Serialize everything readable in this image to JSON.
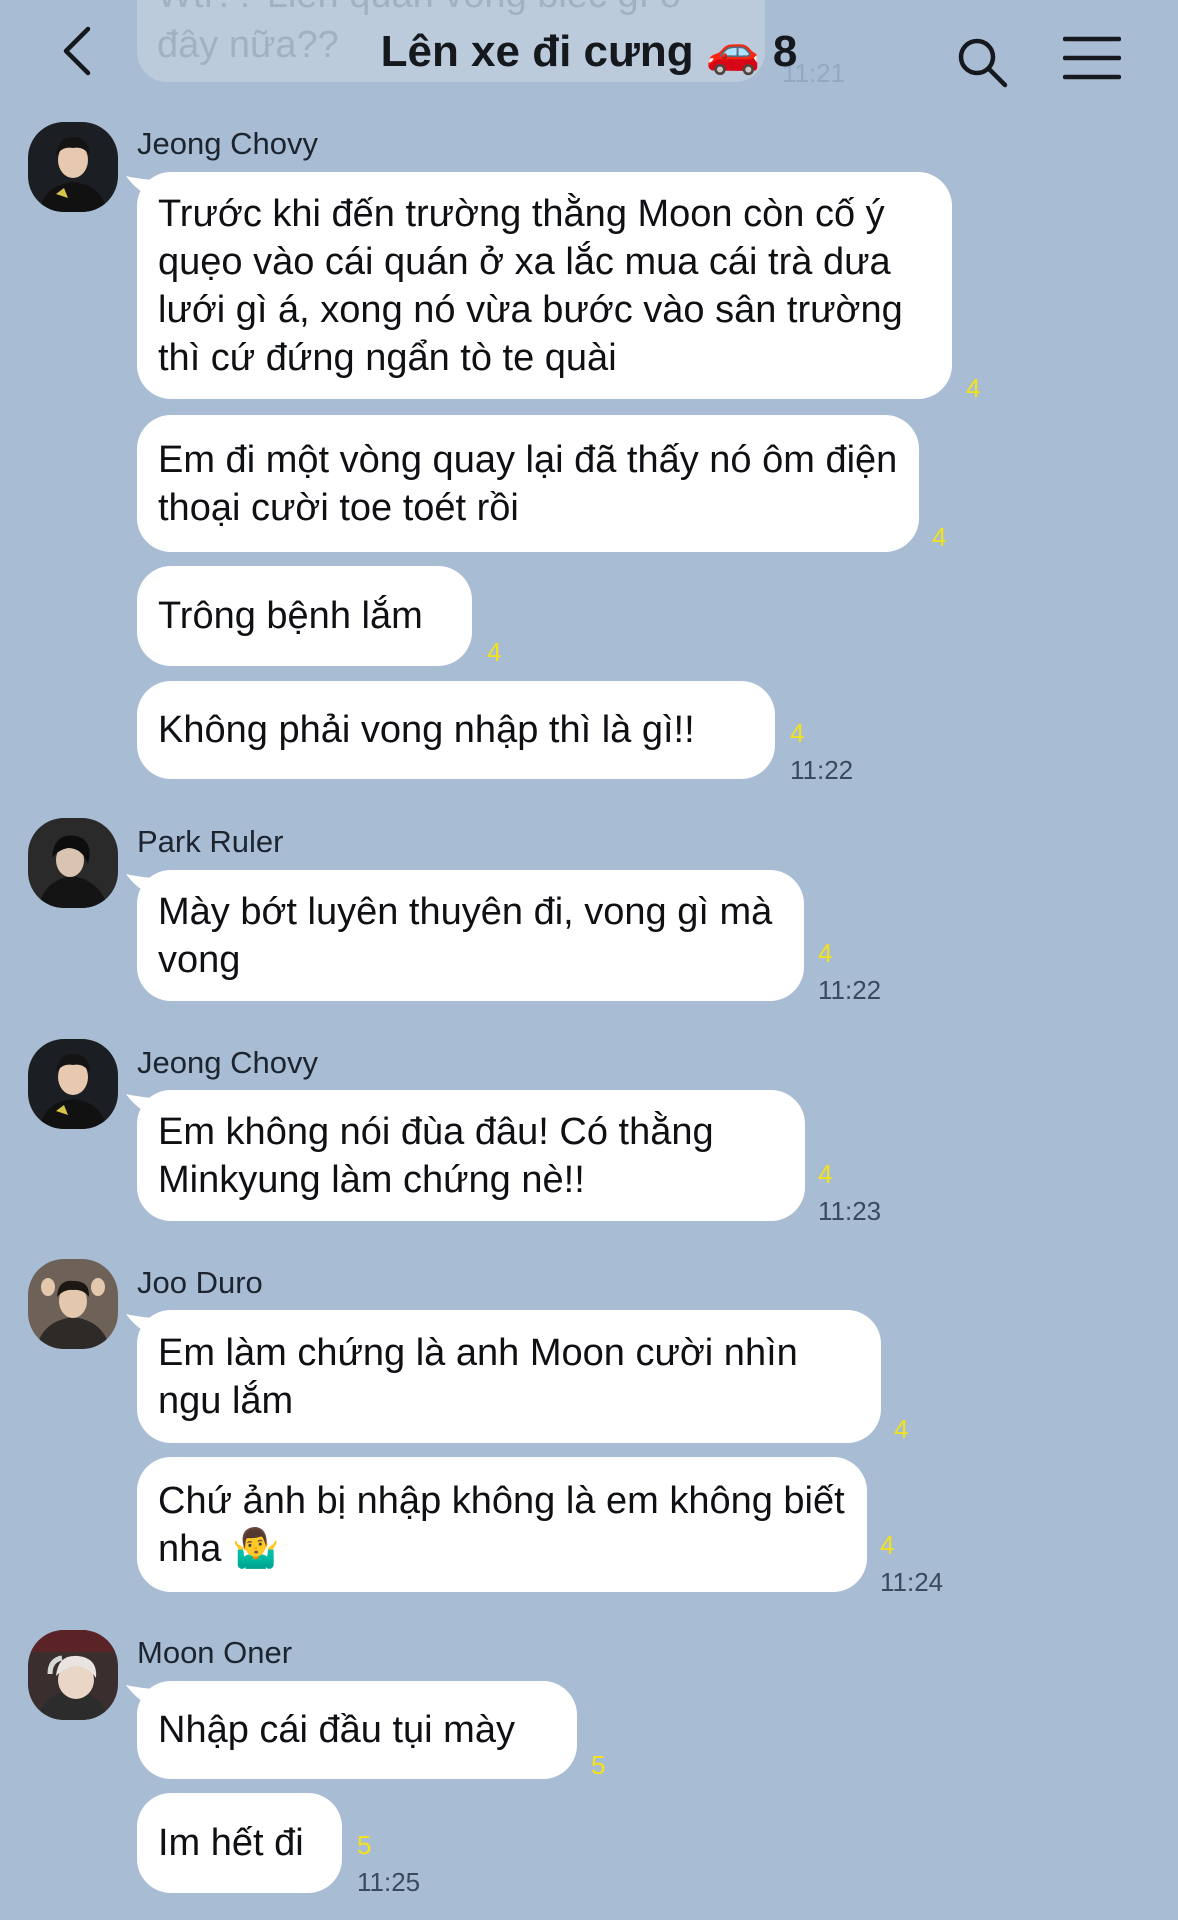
{
  "header": {
    "title": "Lên xe đi cưng 🚗",
    "member_count": "8",
    "prev_message_text": "Wtf?? Liên quan vong biếc gì ở đây nữa??",
    "prev_message_time": "11:21"
  },
  "colors": {
    "background": "#a8bdd3",
    "bubble": "#ffffff",
    "read_count": "#f3e21b"
  },
  "messages": [
    {
      "sender": "Jeong Chovy",
      "text": "Trước khi đến trường thằng Moon còn cố ý quẹo vào cái quán ở xa lắc mua cái trà dưa lưới gì á, xong nó vừa bước vào sân trường thì cứ đứng ngẩn tò te quài",
      "read": "4"
    },
    {
      "text": "Em đi một vòng quay lại đã thấy nó ôm điện thoại cười toe toét rồi",
      "read": "4"
    },
    {
      "text": "Trông bệnh lắm",
      "read": "4"
    },
    {
      "text": "Không phải vong nhập thì là gì!!",
      "read": "4",
      "time": "11:22"
    },
    {
      "sender": "Park Ruler",
      "text": "Mày bớt luyên thuyên đi, vong gì mà vong",
      "read": "4",
      "time": "11:22"
    },
    {
      "sender": "Jeong Chovy",
      "text": "Em không nói đùa đâu! Có thằng Minkyung làm chứng nè!!",
      "read": "4",
      "time": "11:23"
    },
    {
      "sender": "Joo Duro",
      "text": "Em làm chứng là anh Moon cười nhìn ngu lắm",
      "read": "4"
    },
    {
      "text": "Chứ ảnh bị nhập không là em không biết nha 🤷‍♂️",
      "read": "4",
      "time": "11:24"
    },
    {
      "sender": "Moon Oner",
      "text": "Nhập cái đầu tụi mày",
      "read": "5"
    },
    {
      "text": "Im hết đi",
      "read": "5",
      "time": "11:25"
    }
  ]
}
